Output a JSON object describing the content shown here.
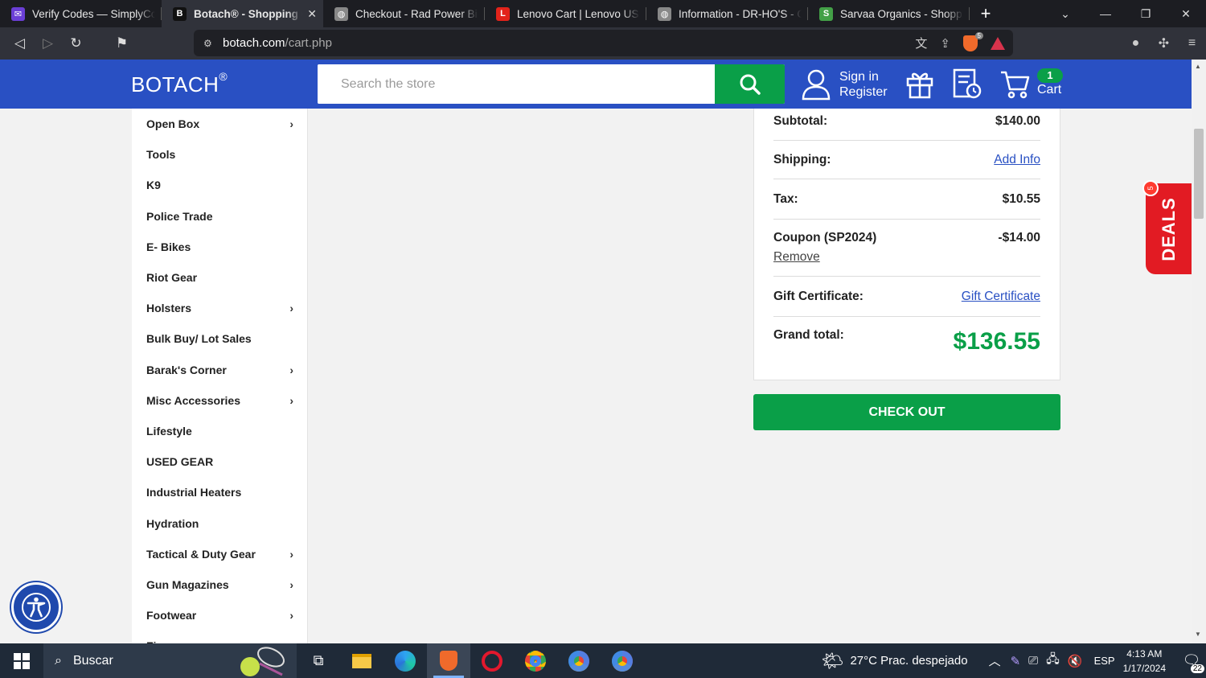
{
  "browser": {
    "tabs": [
      {
        "title": "Verify Codes — SimplyCodes",
        "favicon_color": "#6b3fd6",
        "favicon_glyph": "✉",
        "active": false
      },
      {
        "title": "Botach® - Shopping Cart",
        "favicon_color": "#111111",
        "favicon_glyph": "B",
        "active": true
      },
      {
        "title": "Checkout - Rad Power Bikes",
        "favicon_color": "#888888",
        "favicon_glyph": "◍",
        "active": false
      },
      {
        "title": "Lenovo Cart | Lenovo US",
        "favicon_color": "#e2231a",
        "favicon_glyph": "L",
        "active": false
      },
      {
        "title": "Information - DR-HO'S - Checkout",
        "favicon_color": "#888888",
        "favicon_glyph": "◍",
        "active": false
      },
      {
        "title": "Sarvaa Organics - Shopping Cart",
        "favicon_color": "#43a047",
        "favicon_glyph": "S",
        "active": false
      }
    ],
    "url_host": "botach.com",
    "url_path": "/cart.php",
    "shield_count": "5"
  },
  "header": {
    "logo": "BOTACH",
    "logo_mark": "®",
    "search_placeholder": "Search the store",
    "sign_in": "Sign in",
    "register": "Register",
    "cart_count": "1",
    "cart_label": "Cart"
  },
  "sidebar": {
    "items": [
      {
        "label": "Open Box",
        "has_children": true
      },
      {
        "label": "Tools",
        "has_children": false
      },
      {
        "label": "K9",
        "has_children": false
      },
      {
        "label": "Police Trade",
        "has_children": false
      },
      {
        "label": "E- Bikes",
        "has_children": false
      },
      {
        "label": "Riot Gear",
        "has_children": false
      },
      {
        "label": "Holsters",
        "has_children": true
      },
      {
        "label": "Bulk Buy/ Lot Sales",
        "has_children": false
      },
      {
        "label": "Barak's Corner",
        "has_children": true
      },
      {
        "label": "Misc Accessories",
        "has_children": true
      },
      {
        "label": "Lifestyle",
        "has_children": false
      },
      {
        "label": "USED GEAR",
        "has_children": false
      },
      {
        "label": "Industrial Heaters",
        "has_children": false
      },
      {
        "label": "Hydration",
        "has_children": false
      },
      {
        "label": "Tactical & Duty Gear",
        "has_children": true
      },
      {
        "label": "Gun Magazines",
        "has_children": true
      },
      {
        "label": "Footwear",
        "has_children": true
      },
      {
        "label": "Firearms",
        "has_children": true
      }
    ]
  },
  "summary": {
    "subtotal_label": "Subtotal:",
    "subtotal_value": "$140.00",
    "shipping_label": "Shipping:",
    "shipping_link": "Add Info",
    "tax_label": "Tax:",
    "tax_value": "$10.55",
    "coupon_label": "Coupon (SP2024)",
    "coupon_value": "-$14.00",
    "coupon_remove": "Remove",
    "gift_label": "Gift Certificate:",
    "gift_link": "Gift Certificate",
    "grand_label": "Grand total:",
    "grand_value": "$136.55",
    "checkout_label": "CHECK OUT"
  },
  "deals": {
    "label": "DEALS",
    "badge": "5"
  },
  "taskbar": {
    "search_label": "Buscar",
    "weather": "27°C  Prac. despejado",
    "lang": "ESP",
    "time": "4:13 AM",
    "date": "1/17/2024",
    "notifications": "22"
  },
  "colors": {
    "brand_blue": "#2950c3",
    "brand_green": "#0a9f48",
    "deals_red": "#e21b23"
  }
}
